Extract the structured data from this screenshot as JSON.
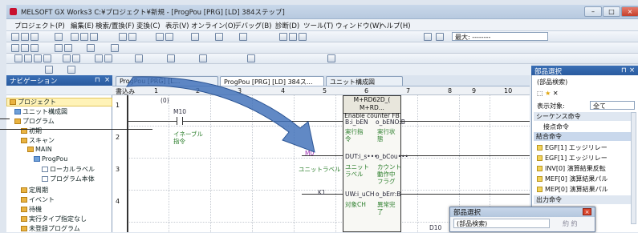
{
  "title_bar": {
    "text": "MELSOFT GX Works3 C:¥プロジェクト¥新規 - [ProgPou [PRG] [LD] 384ステップ]"
  },
  "menu": [
    "プロジェクト(P)",
    "編集(E)",
    "検索/置換(F)",
    "変換(C)",
    "表示(V)",
    "オンライン(O)",
    "デバッグ(B)",
    "診断(D)",
    "ツール(T)",
    "ウィンドウ(W)",
    "ヘルプ(H)"
  ],
  "toolbar": {
    "dropdown_value": "最大: --------"
  },
  "navigation": {
    "title": "ナビゲーション",
    "items": [
      "プロジェクト",
      "ユニット構成図",
      "プログラム",
      "初期",
      "スキャン",
      "MAIN",
      "ProgPou",
      "ローカルラベル",
      "プログラム本体",
      "定周期",
      "イベント",
      "待機",
      "実行タイプ指定なし",
      "未登録プログラム"
    ]
  },
  "tabs": [
    "ProgPou [PRG] [L...",
    "ProgPou [PRG] [LD] 384ス...",
    "ユニット構成図"
  ],
  "editor": {
    "write_label": "書込み",
    "columns": [
      "1",
      "2",
      "3",
      "4",
      "5",
      "6",
      "7",
      "8",
      "9",
      "10"
    ],
    "rows": [
      "1",
      "2",
      "3",
      "4"
    ],
    "step0": "(0)",
    "contact_m10": "M10",
    "comment_enable": "イネーブル\n指令",
    "device_m": "M0",
    "comment_unit": "ユニットラベル",
    "device_k1": "K1",
    "fb_title": "M+RD62D_( M+RD...",
    "fb_subtitle": "Enable counter FB",
    "fb_in": [
      "B:i_bEN",
      "DUT:i_s•••",
      "UW:i_uCH"
    ],
    "fb_out": [
      "o_bENO:B",
      "o_bCou•••",
      "o_bErr:B"
    ],
    "fb_in_cmt": [
      "実行指\n令",
      "ユニット\nラベル",
      "対象CH"
    ],
    "fb_out_cmt": [
      "実行状\n態",
      "カウント\n動作中\nフラグ",
      "異常完\n了"
    ],
    "d_label": "D10"
  },
  "parts": {
    "title": "部品選択",
    "search_label": "(部品検索)",
    "display_label": "表示対象:",
    "display_value": "全て",
    "group1": "シーケンス命令",
    "group2": "接点命令",
    "group3": "結合命令",
    "items": [
      {
        "name": "EGF[1]",
        "desc": "エッジリレー"
      },
      {
        "name": "EGF[1]",
        "desc": "エッジリレー"
      },
      {
        "name": "INV[0]",
        "desc": "演算結果反転"
      },
      {
        "name": "MEF[0]",
        "desc": "演算結果パル"
      },
      {
        "name": "MEP[0]",
        "desc": "演算結果パル"
      }
    ],
    "group4": "出力命令"
  },
  "popup": {
    "title": "部品選択",
    "search": "(部品検索)",
    "buttons": "約 約"
  },
  "colors": {
    "arrow": "#3e6fb8",
    "nav_header": "#2a5b9f"
  }
}
